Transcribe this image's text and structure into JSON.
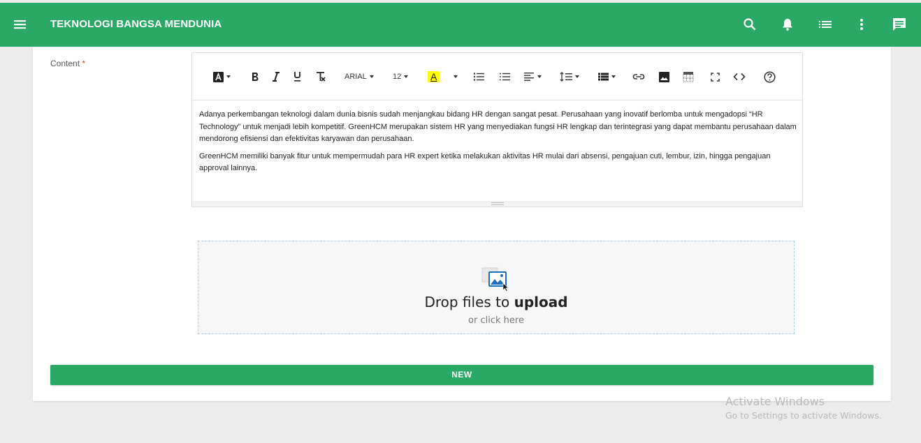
{
  "header": {
    "title": "TEKNOLOGI BANGSA MENDUNIA",
    "background": "#2aa866",
    "icons": [
      "menu-icon",
      "search-icon",
      "bell-icon",
      "list-icon",
      "more-vert-icon",
      "chat-icon"
    ]
  },
  "form": {
    "content_label": "Content",
    "required_mark": "*"
  },
  "editor": {
    "toolbar": {
      "font_name": "ARIAL",
      "font_size": "12",
      "highlight_letter": "A"
    },
    "paragraphs": [
      "Adanya perkembangan teknologi dalam dunia bisnis sudah menjangkau bidang HR dengan sangat pesat. Perusahaan yang inovatif berlomba untuk mengadopsi “HR Technology” untuk menjadi lebih kompetitif. GreenHCM merupakan sistem HR yang menyediakan fungsi HR lengkap dan terintegrasi yang dapat membantu perusahaan dalam mendorong efisiensi dan efektivitas karyawan dan perusahaan.",
      "GreenHCM memiliki banyak fitur untuk mempermudah para HR expert ketika melakukan aktivitas HR mulai dari absensi, pengajuan cuti, lembur, izin, hingga pengajuan approval lainnya."
    ]
  },
  "dropzone": {
    "title_prefix": "Drop files to ",
    "title_bold": "upload",
    "subtitle": "or click here"
  },
  "actions": {
    "new_label": "NEW",
    "accent": "#2aa866"
  },
  "watermark": {
    "line1": "Activate Windows",
    "line2": "Go to Settings to activate Windows."
  }
}
